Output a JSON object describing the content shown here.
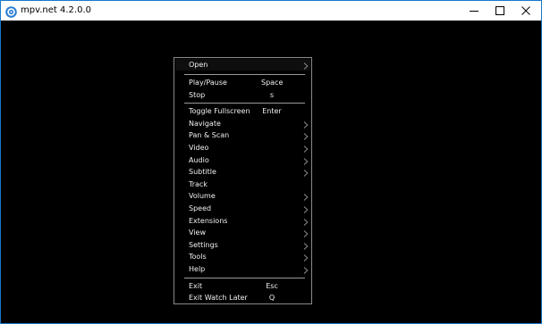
{
  "window": {
    "title": "mpv.net 4.2.0.0",
    "controls": {
      "minimize": "minimize",
      "maximize": "maximize",
      "close": "close"
    },
    "accent_color": "#1979ca"
  },
  "context_menu": {
    "items": [
      {
        "label": "Open",
        "shortcut": "",
        "submenu": true
      },
      {
        "separator": true
      },
      {
        "label": "Play/Pause",
        "shortcut": "Space",
        "submenu": false
      },
      {
        "label": "Stop",
        "shortcut": "s",
        "submenu": false
      },
      {
        "separator": true
      },
      {
        "label": "Toggle Fullscreen",
        "shortcut": "Enter",
        "submenu": false
      },
      {
        "label": "Navigate",
        "shortcut": "",
        "submenu": true
      },
      {
        "label": "Pan & Scan",
        "shortcut": "",
        "submenu": true
      },
      {
        "label": "Video",
        "shortcut": "",
        "submenu": true
      },
      {
        "label": "Audio",
        "shortcut": "",
        "submenu": true
      },
      {
        "label": "Subtitle",
        "shortcut": "",
        "submenu": true
      },
      {
        "label": "Track",
        "shortcut": "",
        "submenu": false
      },
      {
        "label": "Volume",
        "shortcut": "",
        "submenu": true
      },
      {
        "label": "Speed",
        "shortcut": "",
        "submenu": true
      },
      {
        "label": "Extensions",
        "shortcut": "",
        "submenu": true
      },
      {
        "label": "View",
        "shortcut": "",
        "submenu": true
      },
      {
        "label": "Settings",
        "shortcut": "",
        "submenu": true
      },
      {
        "label": "Tools",
        "shortcut": "",
        "submenu": true
      },
      {
        "label": "Help",
        "shortcut": "",
        "submenu": true
      },
      {
        "separator": true
      },
      {
        "label": "Exit",
        "shortcut": "Esc",
        "submenu": false
      },
      {
        "label": "Exit Watch Later",
        "shortcut": "Q",
        "submenu": false
      }
    ]
  }
}
